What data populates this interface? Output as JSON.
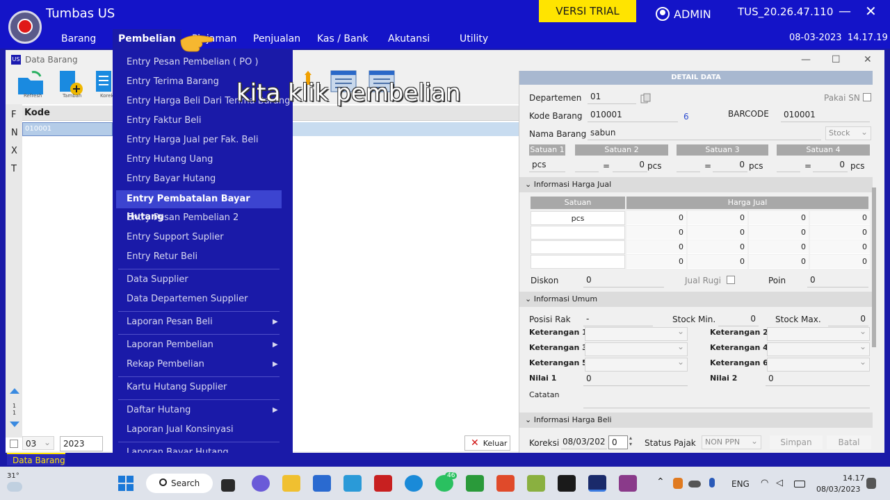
{
  "app": {
    "title": "Tumbas US",
    "trial_label": "VERSI TRIAL",
    "user": "ADMIN",
    "version": "TUS_20.26.47.110",
    "min": "—",
    "close": "✕"
  },
  "menubar": {
    "items": [
      "Barang",
      "Pembelian",
      "Pinjaman",
      "Penjualan",
      "Kas / Bank",
      "Akutansi",
      "Utility"
    ],
    "date": "08-03-2023",
    "time": "14.17.19"
  },
  "window": {
    "title": "Data Barang",
    "icon_text": "US"
  },
  "toolbar": {
    "labels": [
      "Refresh",
      "Tambah",
      "Koreksi"
    ]
  },
  "grid": {
    "header": "Kode",
    "row_value": "010001",
    "side_letters": [
      "F",
      "N",
      "X",
      "T"
    ]
  },
  "bottom": {
    "month": "03",
    "year": "2023",
    "keluar": "Keluar"
  },
  "dropdown": {
    "items": [
      "Entry Pesan Pembelian ( PO )",
      "Entry Terima Barang",
      "Entry Harga Beli Dari Terima Barang",
      "Entry Faktur Beli",
      "Entry Harga Jual per Fak. Beli",
      "Entry Hutang Uang",
      "Entry Bayar Hutang",
      "Entry Pembatalan Bayar Hutang",
      "Entry Pesan Pembelian 2",
      "Entry Support Suplier",
      "Entry Retur Beli",
      "Data Supplier",
      "Data Departemen Supplier",
      "Laporan Pesan Beli",
      "Laporan Pembelian",
      "Rekap Pembelian",
      "Kartu Hutang Supplier",
      "Daftar Hutang",
      "Laporan Jual Konsinyasi",
      "Laporan Bayar Hutang"
    ],
    "highlighted": "Entry Pembatalan Bayar Hutang"
  },
  "caption": "kita klik pembelian",
  "detail": {
    "header": "DETAIL DATA",
    "departemen_label": "Departemen",
    "departemen": "01",
    "pakai_sn": "Pakai SN",
    "kode_label": "Kode Barang",
    "kode": "010001",
    "kode_count": "6",
    "barcode_label": "BARCODE",
    "barcode": "010001",
    "nama_label": "Nama Barang",
    "nama": "sabun",
    "stock_combo": "Stock",
    "satuan_headers": [
      "Satuan 1",
      "Satuan 2",
      "Satuan 3",
      "Satuan 4"
    ],
    "satuan1": "pcs",
    "eq": "=",
    "zero": "0",
    "pcs": "pcs",
    "harga_jual_section": "Informasi Harga Jual",
    "tbl_satuan": "Satuan",
    "tbl_harga": "Harga Jual",
    "diskon_label": "Diskon",
    "diskon": "0",
    "jual_rugi": "Jual Rugi",
    "poin_label": "Poin",
    "poin": "0",
    "umum_section": "Informasi Umum",
    "posisi_rak_label": "Posisi Rak",
    "posisi_rak": "-",
    "stock_min_label": "Stock Min.",
    "stock_min": "0",
    "stock_max_label": "Stock Max.",
    "stock_max": "0",
    "ket1": "Keterangan 1",
    "ket2": "Keterangan 2",
    "ket3": "Keterangan 3",
    "ket4": "Keterangan 4",
    "ket5": "Keterangan 5",
    "ket6": "Keterangan 6",
    "nilai1_label": "Nilai 1",
    "nilai1": "0",
    "nilai2_label": "Nilai 2",
    "nilai2": "0",
    "catatan_label": "Catatan",
    "harga_beli_section": "Informasi Harga Beli",
    "koreksi_label": "Koreksi",
    "koreksi_date": "08/03/202",
    "koreksi_num": "0",
    "status_pajak_label": "Status Pajak",
    "status_pajak": "NON PPN",
    "simpan": "Simpan",
    "batal": "Batal"
  },
  "statusbar": {
    "tab": "Data Barang"
  },
  "taskbar": {
    "temp": "31°",
    "search": "Search",
    "badge": "46",
    "lang": "ENG",
    "time": "14.17",
    "date": "08/03/2023"
  },
  "colors": {
    "menubar": "#1414c8",
    "dropdown": "#1a1aa8",
    "highlight": "#3c44d0",
    "trial": "#ffe400"
  }
}
